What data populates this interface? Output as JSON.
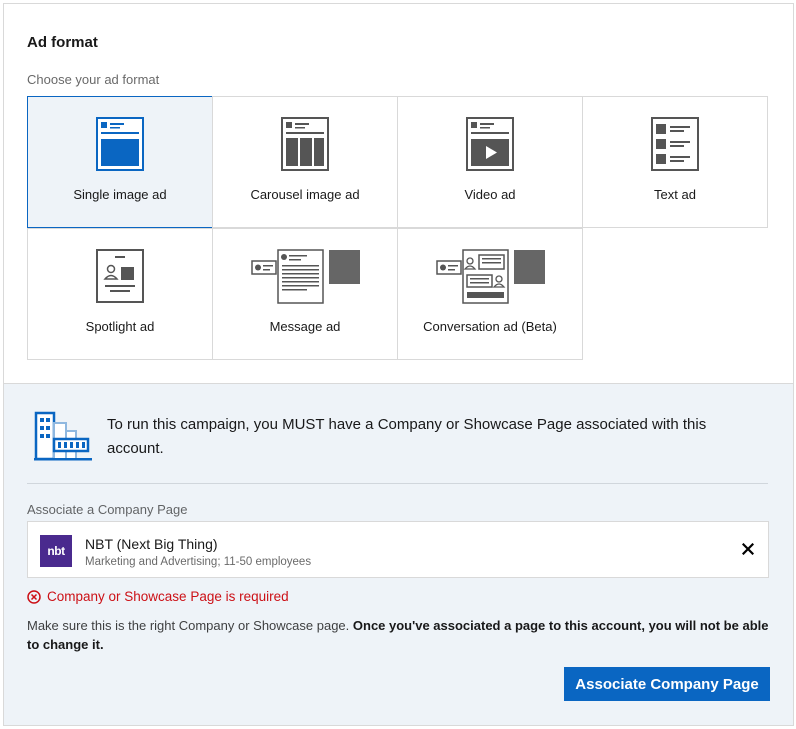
{
  "section": {
    "title": "Ad format",
    "subtitle": "Choose your ad format"
  },
  "ad_formats": [
    {
      "label": "Single image ad",
      "icon": "single-image-ad-icon",
      "selected": true
    },
    {
      "label": "Carousel image ad",
      "icon": "carousel-image-ad-icon",
      "selected": false
    },
    {
      "label": "Video ad",
      "icon": "video-ad-icon",
      "selected": false
    },
    {
      "label": "Text ad",
      "icon": "text-ad-icon",
      "selected": false
    },
    {
      "label": "Spotlight ad",
      "icon": "spotlight-ad-icon",
      "selected": false
    },
    {
      "label": "Message ad",
      "icon": "message-ad-icon",
      "selected": false
    },
    {
      "label": "Conversation ad (Beta)",
      "icon": "conversation-ad-icon",
      "selected": false
    }
  ],
  "notice": {
    "message": "To run this campaign, you MUST have a Company or Showcase Page associated with this account.",
    "icon": "company-building-icon"
  },
  "company": {
    "label": "Associate a Company Page",
    "logo_text": "nbt",
    "name": "NBT (Next Big Thing)",
    "description": "Marketing and Advertising; 11-50 employees",
    "remove_icon": "close-icon"
  },
  "error": {
    "text": "Company or Showcase Page is required",
    "icon": "error-circle-icon"
  },
  "note": {
    "part1": "Make sure this is the right Company or Showcase page. ",
    "part2": "Once you've associated a page to this account, you will not be able to change it."
  },
  "actions": {
    "associate_label": "Associate Company Page"
  },
  "colors": {
    "accent": "#0a66c2",
    "selected_bg": "#eef3f8",
    "error": "#cc1016",
    "logo_bg": "#4a2a8e"
  }
}
